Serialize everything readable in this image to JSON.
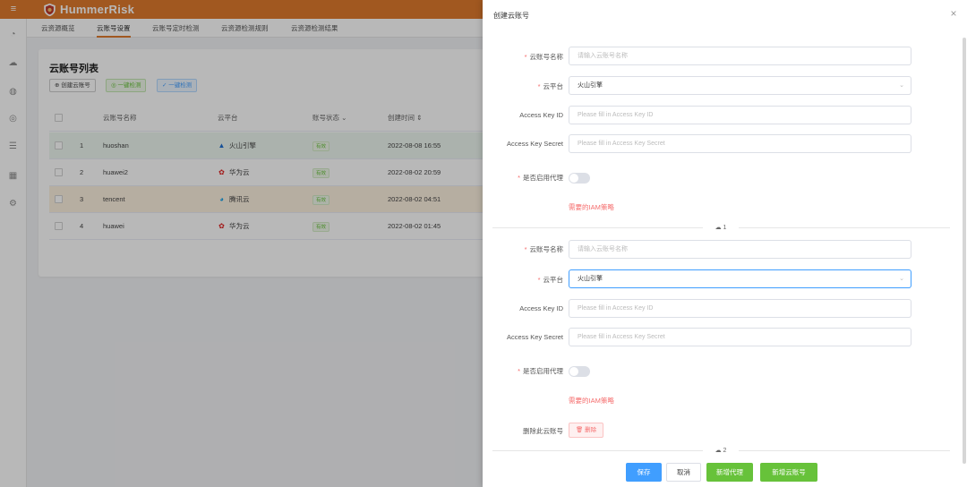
{
  "app": {
    "name": "HummerRisk",
    "brand_color": "#e07a2d"
  },
  "sidebar": {
    "icons": [
      "dashboard-icon",
      "cloud-icon",
      "account-icon",
      "security-icon",
      "list-icon",
      "grid-icon",
      "settings-icon"
    ]
  },
  "tabs": [
    {
      "label": "云资源概览"
    },
    {
      "label": "云账号设置",
      "active": true
    },
    {
      "label": "云账号定时检测"
    },
    {
      "label": "云资源检测规则"
    },
    {
      "label": "云资源检测结果"
    }
  ],
  "list": {
    "title": "云账号列表",
    "create_label": "创建云账号",
    "check_label_1": "一键检测",
    "check_label_2": "一键检测",
    "columns": {
      "name": "云账号名称",
      "platform": "云平台",
      "status": "账号状态",
      "created": "创建时间"
    },
    "rows": [
      {
        "index": "1",
        "name": "huoshan",
        "platform": "火山引擎",
        "status": "有效",
        "created": "2022-08-08 16:55"
      },
      {
        "index": "2",
        "name": "huawei2",
        "platform": "华为云",
        "status": "有效",
        "created": "2022-08-02 20:59"
      },
      {
        "index": "3",
        "name": "tencent",
        "platform": "腾讯云",
        "status": "有效",
        "created": "2022-08-02 04:51"
      },
      {
        "index": "4",
        "name": "huawei",
        "platform": "华为云",
        "status": "有效",
        "created": "2022-08-02 01:45"
      }
    ]
  },
  "drawer": {
    "title": "创建云账号",
    "accounts": [
      {
        "name_label": "云账号名称",
        "name_placeholder": "请输入云账号名称",
        "platform_label": "云平台",
        "platform_value": "火山引擎",
        "ak_label": "Access Key ID",
        "ak_placeholder": "Please fill in Access Key ID",
        "sk_label": "Access Key Secret",
        "sk_placeholder": "Please fill in Access Key Secret",
        "proxy_label": "是否启用代理",
        "proxy_enabled": false,
        "iam_link": "需要的IAM策略",
        "divider": "1"
      },
      {
        "name_label": "云账号名称",
        "name_placeholder": "请输入云账号名称",
        "platform_label": "云平台",
        "platform_value": "火山引擎",
        "ak_label": "Access Key ID",
        "ak_placeholder": "Please fill in Access Key ID",
        "sk_label": "Access Key Secret",
        "sk_placeholder": "Please fill in Access Key Secret",
        "proxy_label": "是否启用代理",
        "proxy_enabled": false,
        "iam_link": "需要的IAM策略",
        "delete_label": "删除此云账号",
        "delete_button": "删除",
        "divider": "2"
      }
    ],
    "footer": {
      "save": "保存",
      "cancel": "取消",
      "add_proxy": "新增代理",
      "add_account": "新增云账号"
    }
  }
}
